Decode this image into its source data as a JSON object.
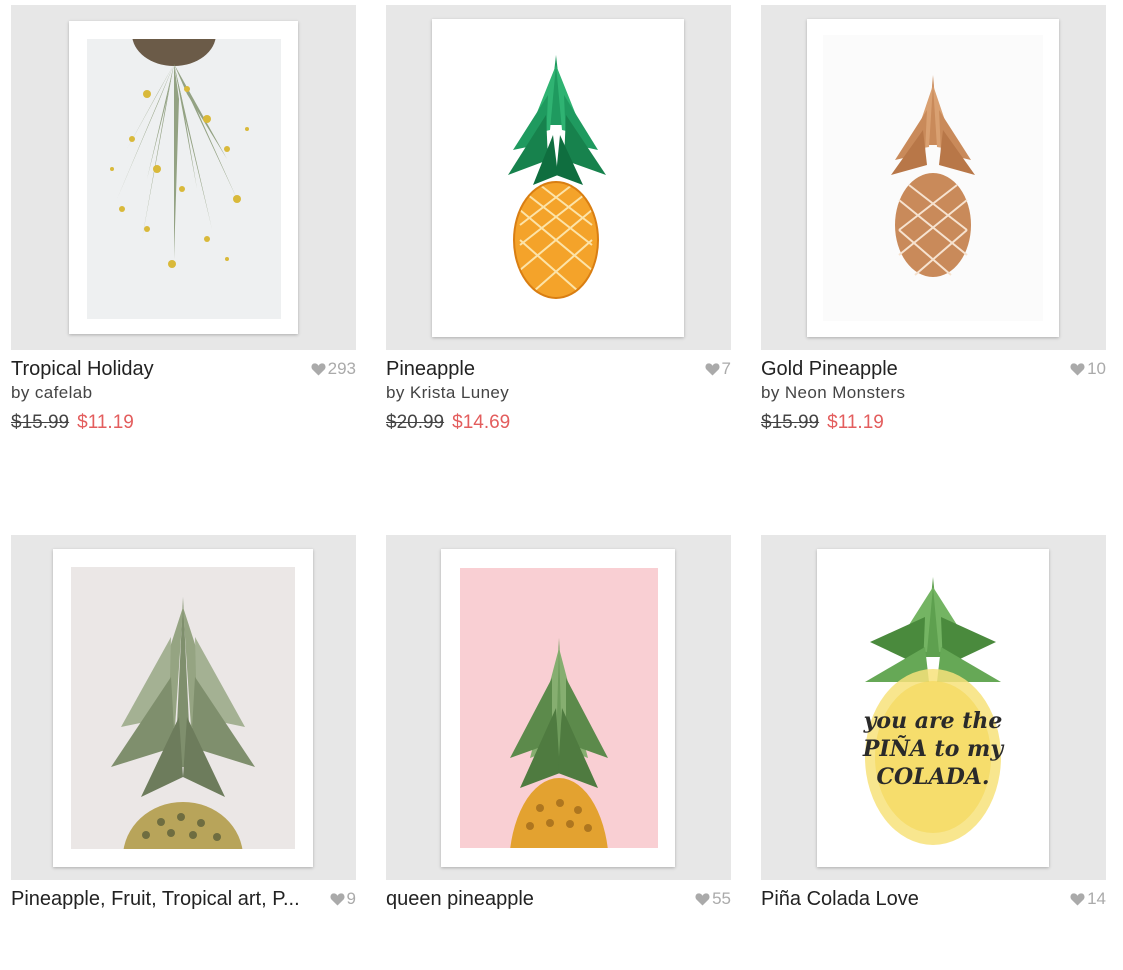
{
  "colors": {
    "sale_price": "#e35d5d",
    "thumb_bg": "#e7e7e7",
    "like_icon": "#aaaaaa"
  },
  "products": [
    {
      "title": "Tropical Holiday",
      "artist": "by cafelab",
      "likes": "293",
      "old_price": "$15.99",
      "new_price": "$11.19",
      "art": "upside-down pineapple crown with gold dots"
    },
    {
      "title": "Pineapple",
      "artist": "by Krista Luney",
      "likes": "7",
      "old_price": "$20.99",
      "new_price": "$14.69",
      "art": "watercolor orange pineapple with green crown"
    },
    {
      "title": "Gold Pineapple",
      "artist": "by Neon Monsters",
      "likes": "10",
      "old_price": "$15.99",
      "new_price": "$11.19",
      "art": "rose gold foil pineapple"
    },
    {
      "title": "Pineapple, Fruit, Tropical art, P...",
      "likes": "9",
      "art": "pineapple crown photograph on grey"
    },
    {
      "title": "queen pineapple",
      "likes": "55",
      "art": "pineapple on pink background"
    },
    {
      "title": "Piña Colada Love",
      "likes": "14",
      "art": "watercolor pineapple with lettering",
      "lettering": "you are the PIÑA to my COLADA."
    }
  ]
}
